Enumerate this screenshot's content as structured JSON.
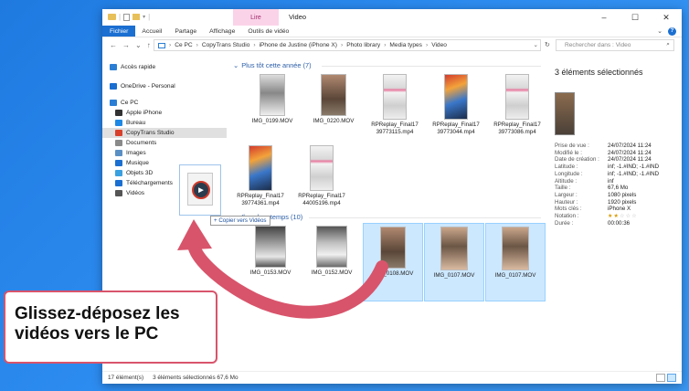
{
  "window": {
    "title": "Video",
    "context_tab": "Lire",
    "controls": [
      "–",
      "☐",
      "✕"
    ]
  },
  "ribbon": {
    "tabs": [
      "Fichier",
      "Accueil",
      "Partage",
      "Affichage",
      "Outils de vidéo"
    ]
  },
  "address": {
    "nav": [
      "←",
      "→",
      "⌄",
      "↑"
    ],
    "crumbs": [
      "Ce PC",
      "CopyTrans Studio",
      "iPhone de Justine (iPhone X)",
      "Photo library",
      "Media types",
      "Video"
    ],
    "search_placeholder": "Rechercher dans : Video"
  },
  "sidebar": {
    "items": [
      {
        "label": "Accès rapide",
        "icon": "star-icon",
        "color": "#2a7fd4"
      },
      {
        "label": "OneDrive - Personal",
        "icon": "cloud-icon",
        "color": "#1b6fd1"
      },
      {
        "label": "Ce PC",
        "icon": "monitor-icon",
        "color": "#2a7fd4"
      },
      {
        "label": "Apple iPhone",
        "icon": "phone-icon",
        "color": "#333333"
      },
      {
        "label": "Bureau",
        "icon": "desktop-icon",
        "color": "#1e88e5"
      },
      {
        "label": "CopyTrans Studio",
        "icon": "copytrans-icon",
        "color": "#d8402c"
      },
      {
        "label": "Documents",
        "icon": "document-icon",
        "color": "#8a8a8a"
      },
      {
        "label": "Images",
        "icon": "image-icon",
        "color": "#5a8fc4"
      },
      {
        "label": "Musique",
        "icon": "music-icon",
        "color": "#1b6fd1"
      },
      {
        "label": "Objets 3D",
        "icon": "cube-icon",
        "color": "#3aa0e0"
      },
      {
        "label": "Téléchargements",
        "icon": "download-icon",
        "color": "#1b6fd1"
      },
      {
        "label": "Vidéos",
        "icon": "video-icon",
        "color": "#555555"
      }
    ]
  },
  "groups": [
    {
      "label": "Plus tôt cette année (7)"
    },
    {
      "label": "Il y a longtemps (10)"
    }
  ],
  "files_recent": [
    {
      "name": "IMG_0199.MOV",
      "thumb": "snow",
      "selected": false
    },
    {
      "name": "IMG_0220.MOV",
      "thumb": "cat",
      "selected": false
    },
    {
      "name": "RPReplay_Final17 39773115.mp4",
      "thumb": "phone",
      "selected": false
    },
    {
      "name": "RPReplay_Final17 39773044.mp4",
      "thumb": "phone-home",
      "selected": false
    },
    {
      "name": "RPReplay_Final17 39773086.mp4",
      "thumb": "phone",
      "selected": false
    },
    {
      "name": "RPReplay_Final17 39774361.mp4",
      "thumb": "phone-home",
      "selected": false
    },
    {
      "name": "RPReplay_Final17 44005196.mp4",
      "thumb": "phone",
      "selected": false
    }
  ],
  "files_old": [
    {
      "name": "IMG_0153.MOV",
      "thumb": "window-snow",
      "selected": false
    },
    {
      "name": "IMG_0152.MOV",
      "thumb": "window",
      "selected": false
    },
    {
      "name": "IMG_0108.MOV",
      "thumb": "cat",
      "selected": true
    },
    {
      "name": "IMG_0107.MOV",
      "thumb": "cat-hand",
      "selected": true
    },
    {
      "name": "IMG_0107.MOV",
      "thumb": "cat-hand",
      "selected": true
    }
  ],
  "drag": {
    "badge": "+ Copier vers Vidéos"
  },
  "details": {
    "title": "3 éléments sélectionnés",
    "props": [
      {
        "k": "Prise de vue :",
        "v": "24/07/2024 11:24"
      },
      {
        "k": "Modifié le :",
        "v": "24/07/2024 11:24"
      },
      {
        "k": "Date de création :",
        "v": "24/07/2024 11:24"
      },
      {
        "k": "Latitude :",
        "v": "inf; -1.#IND; -1.#IND"
      },
      {
        "k": "Longitude :",
        "v": "inf; -1.#IND; -1.#IND"
      },
      {
        "k": "Altitude :",
        "v": "inf"
      },
      {
        "k": "Taille :",
        "v": "67,6 Mo"
      },
      {
        "k": "Largeur :",
        "v": "1080 pixels"
      },
      {
        "k": "Hauteur :",
        "v": "1920 pixels"
      },
      {
        "k": "Mots clés :",
        "v": "iPhone X"
      },
      {
        "k": "Notation :",
        "v": ""
      },
      {
        "k": "Durée :",
        "v": "00:00:36"
      }
    ],
    "rating": 2,
    "rating_max": 5
  },
  "status": {
    "count": "17 élément(s)",
    "selection": "3 éléments sélectionnés  67,6 Mo"
  },
  "callout": {
    "line1": "Glissez-déposez les",
    "line2": "vidéos vers le PC"
  },
  "colors": {
    "accent": "#1b6fd1",
    "arrow": "#d8546b",
    "selection": "#cce8ff"
  }
}
